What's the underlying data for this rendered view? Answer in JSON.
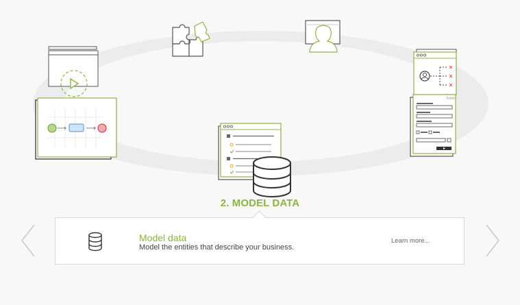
{
  "carousel": {
    "active_step_label": "2. MODEL DATA",
    "steps": [
      {
        "icon": "process-flow-icon"
      },
      {
        "icon": "puzzle-icon"
      },
      {
        "icon": "user-monitor-icon"
      },
      {
        "icon": "permissions-tree-icon"
      },
      {
        "icon": "form-icon"
      },
      {
        "icon": "database-icon"
      }
    ]
  },
  "form_icon": {
    "title": "Form"
  },
  "info": {
    "icon": "database-icon",
    "title": "Model data",
    "description": "Model the entities that describe your business.",
    "link_label": "Learn more..."
  },
  "nav": {
    "prev": "chevron-left-icon",
    "next": "chevron-right-icon"
  },
  "colors": {
    "accent": "#8cb443",
    "dark": "#444444",
    "node_start": "#b5d98a",
    "node_end": "#f2a8ac",
    "node_mid": "#cfe3f7",
    "cross": "#e05b5b"
  }
}
